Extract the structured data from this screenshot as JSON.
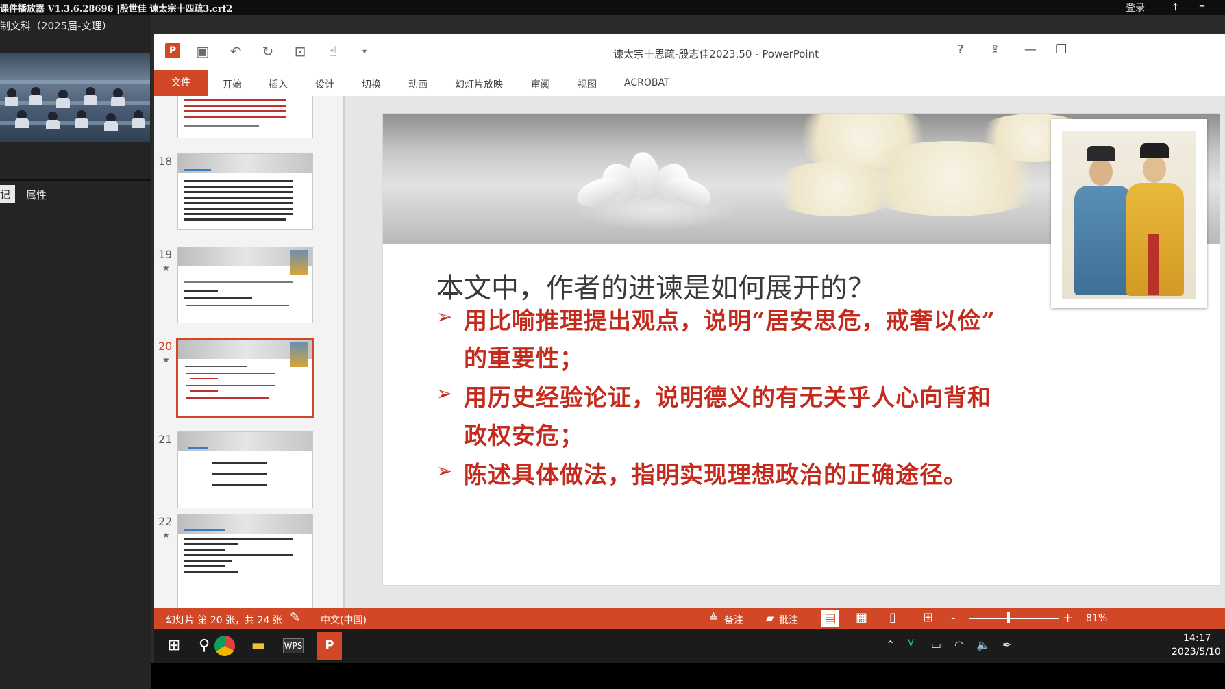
{
  "player": {
    "title": "课件播放器 V1.3.6.28696 |殷世佳 谏太宗十四疏3.crf2",
    "login": "登录",
    "pin_icon": "pin-icon",
    "min_icon": "minimize-icon"
  },
  "left_panel": {
    "course_name": "制文科（2025届-文理）",
    "tab_notes": "记",
    "tab_properties": "属性"
  },
  "ppt": {
    "window_title": "谏太宗十思疏-殷志佳2023.50 - PowerPoint",
    "help": "?",
    "ribbon_tabs": [
      "文件",
      "开始",
      "插入",
      "设计",
      "切换",
      "动画",
      "幻灯片放映",
      "审阅",
      "视图",
      "ACROBAT"
    ],
    "accent_color": "#d24726"
  },
  "thumbnails": [
    {
      "number": "",
      "star": ""
    },
    {
      "number": "18",
      "star": ""
    },
    {
      "number": "19",
      "star": "★"
    },
    {
      "number": "20",
      "star": "★",
      "selected": true
    },
    {
      "number": "21",
      "star": ""
    },
    {
      "number": "22",
      "star": "★"
    }
  ],
  "slide": {
    "question": "本文中，作者的进谏是如何展开的？",
    "bullets": [
      {
        "mark": "➢",
        "line1": "用比喻推理提出观点，说明“居安思危，戒奢以俭”",
        "line2": "的重要性；"
      },
      {
        "mark": "➢",
        "line1": "用历史经验论证，说明德义的有无关乎人心向背和",
        "line2": "政权安危；"
      },
      {
        "mark": "➢",
        "line1": "陈述具体做法，指明实现理想政治的正确途径。",
        "line2": ""
      }
    ],
    "text_color": "#c42b1c"
  },
  "statusbar": {
    "slide_info": "幻灯片 第 20 张，共 24 张",
    "language": "中文(中国)",
    "notes": "备注",
    "comments": "批注",
    "zoom_minus": "-",
    "zoom_plus": "+",
    "zoom": "81%",
    "zoom_level_percent": 81
  },
  "taskbar": {
    "time": "14:17",
    "date": "2023/5/10"
  }
}
